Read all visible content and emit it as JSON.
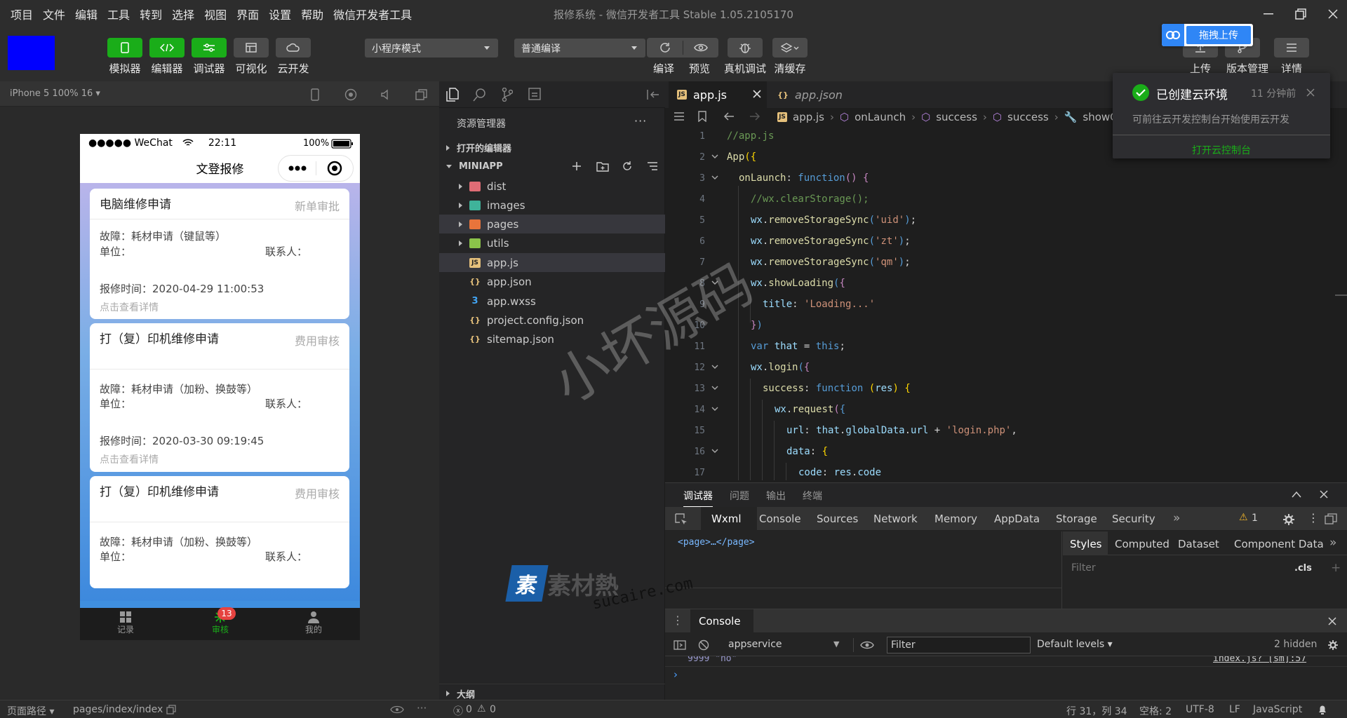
{
  "menu": [
    "项目",
    "文件",
    "编辑",
    "工具",
    "转到",
    "选择",
    "视图",
    "界面",
    "设置",
    "帮助",
    "微信开发者工具"
  ],
  "window_title": "报修系统 - 微信开发者工具 Stable 1.05.2105170",
  "toolbar": {
    "buttons": [
      "模拟器",
      "编辑器",
      "调试器",
      "可视化",
      "云开发"
    ],
    "mode": "小程序模式",
    "compile": "普通编译",
    "right_buttons": [
      "编译",
      "预览",
      "真机调试",
      "清缓存"
    ],
    "upload_tooltip": "拖拽上传",
    "far_right": [
      "上传",
      "版本管理",
      "详情"
    ]
  },
  "simulator": {
    "device": "iPhone 5 100% 16",
    "status_carrier": "●●●●● WeChat",
    "status_time": "22:11",
    "status_battery": "100%",
    "nav_title": "文登报修",
    "cards": [
      {
        "title": "电脑维修申请",
        "status": "新单审批",
        "fault": "故障：耗材申请（键鼠等）",
        "unit": "单位：",
        "contact": "联系人：",
        "time": "报修时间：2020-04-29 11:00:53",
        "link": "点击查看详情"
      },
      {
        "title": "打（复）印机维修申请",
        "status": "费用审核",
        "fault": "故障：耗材申请（加粉、换鼓等）",
        "unit": "单位：",
        "contact": "联系人：",
        "time": "报修时间：2020-03-30 09:19:45",
        "link": "点击查看详情"
      },
      {
        "title": "打（复）印机维修申请",
        "status": "费用审核",
        "fault": "故障：耗材申请（加粉、换鼓等）",
        "unit": "单位：",
        "contact": "联系人："
      }
    ],
    "tabs": [
      "记录",
      "审核",
      "我的"
    ],
    "badge": "13"
  },
  "explorer": {
    "title": "资源管理器",
    "open_editors": "打开的编辑器",
    "project": "MINIAPP",
    "items": [
      {
        "name": "dist",
        "type": "folder",
        "color": "#e06c75"
      },
      {
        "name": "images",
        "type": "folder",
        "color": "#3fb39a"
      },
      {
        "name": "pages",
        "type": "folder",
        "color": "#e8743b"
      },
      {
        "name": "utils",
        "type": "folder",
        "color": "#8bc34a"
      },
      {
        "name": "app.js",
        "type": "js",
        "color": "#e5c07b"
      },
      {
        "name": "app.json",
        "type": "json",
        "color": "#e5c07b"
      },
      {
        "name": "app.wxss",
        "type": "css",
        "color": "#42a5f5"
      },
      {
        "name": "project.config.json",
        "type": "json",
        "color": "#e5c07b"
      },
      {
        "name": "sitemap.json",
        "type": "json",
        "color": "#e5c07b"
      }
    ],
    "outline": "大纲"
  },
  "editor": {
    "tabs": [
      {
        "name": "app.js",
        "active": true
      },
      {
        "name": "app.json",
        "active": false
      }
    ],
    "breadcrumb": [
      "app.js",
      "onLaunch",
      "success",
      "success",
      "showC"
    ]
  },
  "debugger": {
    "tabs": [
      "调试器",
      "问题",
      "输出",
      "终端"
    ],
    "devtabs": [
      "Wxml",
      "Console",
      "Sources",
      "Network",
      "Memory",
      "AppData",
      "Storage",
      "Security"
    ],
    "warn_count": "1",
    "wxml": "<page>…</page>",
    "style_tabs": [
      "Styles",
      "Computed",
      "Dataset",
      "Component Data"
    ],
    "filter_placeholder": "Filter",
    "cls": ".cls",
    "console_title": "Console",
    "context": "appservice",
    "console_filter": "Filter",
    "levels": "Default levels",
    "hidden": "2 hidden",
    "log_line": "9999 \"no\"",
    "log_source": "index.js? [sm]:57"
  },
  "notification": {
    "title": "已创建云环境",
    "time": "11 分钟前",
    "body": "可前往云开发控制台开始使用云开发",
    "action": "打开云控制台"
  },
  "statusbar": {
    "path_label": "页面路径",
    "path": "pages/index/index",
    "errors": "0",
    "warnings": "0",
    "cursor": "行 31，列 34",
    "spaces": "空格: 2",
    "encoding": "UTF-8",
    "eol": "LF",
    "lang": "JavaScript"
  },
  "watermarks": [
    "小坏源码",
    "素材熱",
    "sucaire.com"
  ]
}
